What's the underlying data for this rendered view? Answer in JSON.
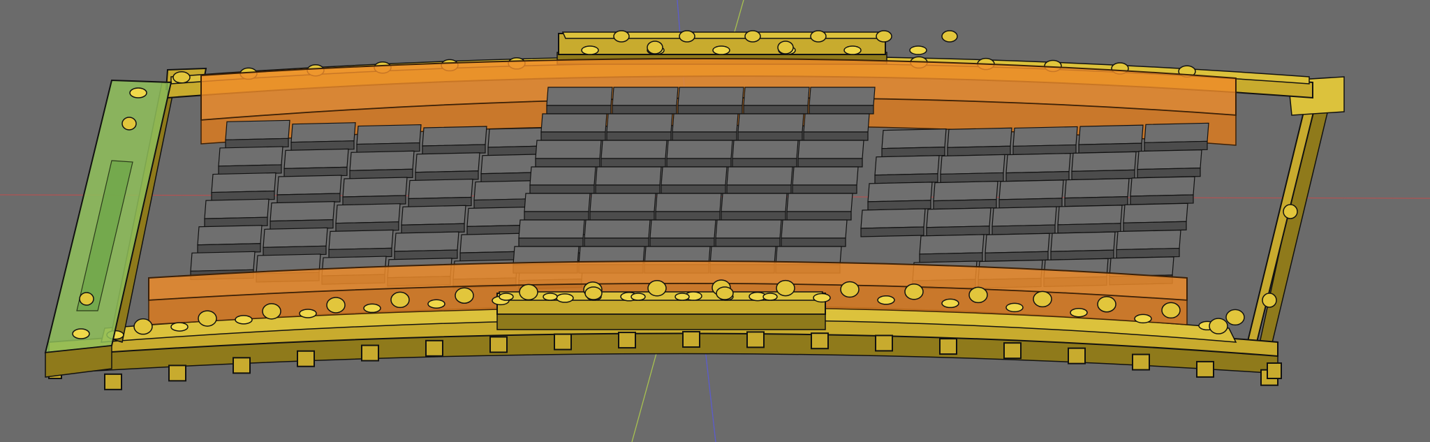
{
  "viewport": {
    "background": "#6b6b6b",
    "colors": {
      "frame": "#c8ab2e",
      "rail": "#f08c2a",
      "brick": "#6f6f6f",
      "end_plate": "#8fbf5a",
      "axis_x": "#dd4444",
      "axis_y": "#b8d84a",
      "axis_z": "#5a5ad8"
    }
  },
  "scene": {
    "objects": [
      {
        "name": "outer-frame",
        "color": "#c8ab2e"
      },
      {
        "name": "top-orange-rail",
        "color": "#f08c2a"
      },
      {
        "name": "bottom-orange-rail",
        "color": "#f08c2a"
      },
      {
        "name": "brick-array",
        "color": "#6f6f6f"
      },
      {
        "name": "left-green-end-plate",
        "color": "#8fbf5a"
      },
      {
        "name": "top-center-clamp",
        "color": "#c8ab2e"
      },
      {
        "name": "bottom-center-clamp",
        "color": "#c8ab2e"
      }
    ]
  }
}
